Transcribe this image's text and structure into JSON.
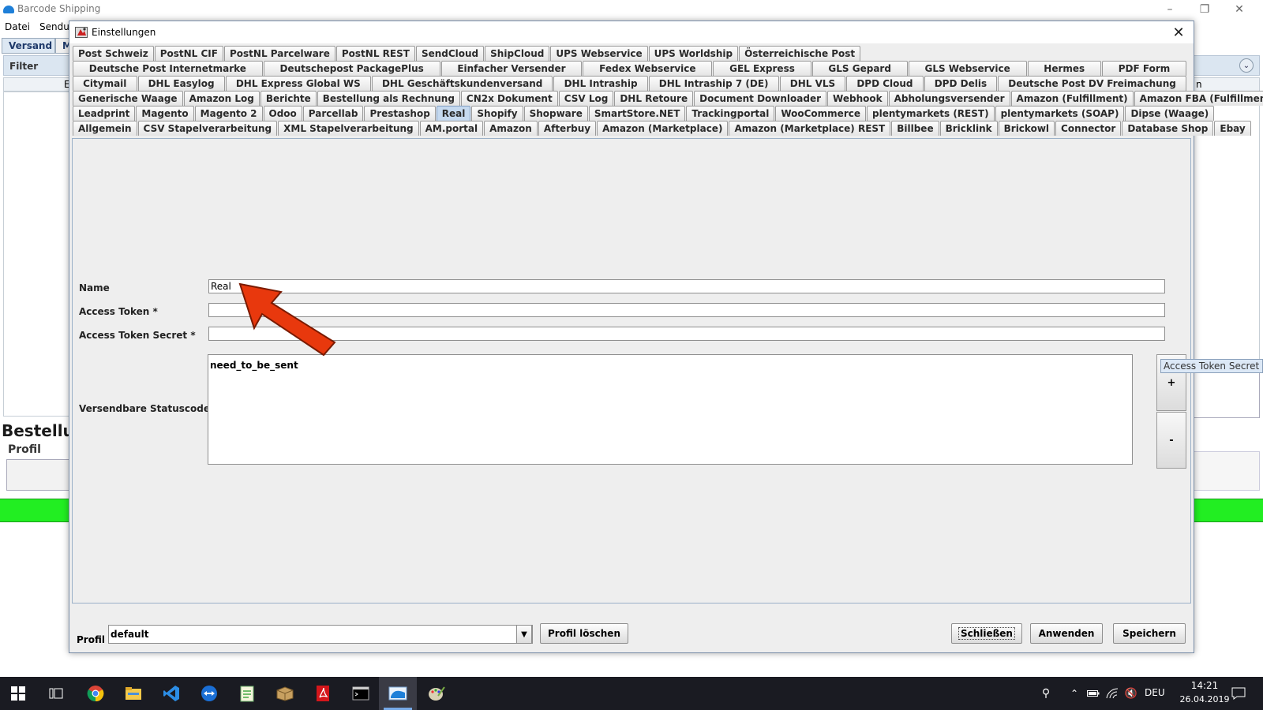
{
  "main": {
    "title": "Barcode Shipping",
    "menu": [
      "Datei",
      "Sendu"
    ],
    "tabs": [
      "Versand",
      "M"
    ],
    "filter_label": "Filter",
    "section_heading": "Bestellu",
    "profile_label": "Profil",
    "col_partial_left": "E",
    "col_partial_right": "n"
  },
  "dialog": {
    "title": "Einstellungen",
    "tab_rows": [
      [
        "Post Schweiz",
        "PostNL CIF",
        "PostNL Parcelware",
        "PostNL REST",
        "SendCloud",
        "ShipCloud",
        "UPS Webservice",
        "UPS Worldship",
        "Österreichische Post"
      ],
      [
        "Deutsche Post Internetmarke",
        "Deutschepost PackagePlus",
        "Einfacher Versender",
        "Fedex Webservice",
        "GEL Express",
        "GLS Gepard",
        "GLS Webservice",
        "Hermes",
        "PDF Form"
      ],
      [
        "Citymail",
        "DHL Easylog",
        "DHL Express Global WS",
        "DHL Geschäftskundenversand",
        "DHL Intraship",
        "DHL Intraship 7 (DE)",
        "DHL VLS",
        "DPD Cloud",
        "DPD Delis",
        "Deutsche Post DV Freimachung"
      ],
      [
        "Generische Waage",
        "Amazon Log",
        "Berichte",
        "Bestellung als Rechnung",
        "CN2x Dokument",
        "CSV Log",
        "DHL Retoure",
        "Document Downloader",
        "Webhook",
        "Abholungsversender",
        "Amazon (Fulfillment)",
        "Amazon FBA (Fulfillment)"
      ],
      [
        "Leadprint",
        "Magento",
        "Magento 2",
        "Odoo",
        "Parcellab",
        "Prestashop",
        "Real",
        "Shopify",
        "Shopware",
        "SmartStore.NET",
        "Trackingportal",
        "WooCommerce",
        "plentymarkets (REST)",
        "plentymarkets (SOAP)",
        "Dipse (Waage)"
      ],
      [
        "Allgemein",
        "CSV Stapelverarbeitung",
        "XML Stapelverarbeitung",
        "AM.portal",
        "Amazon",
        "Afterbuy",
        "Amazon (Marketplace)",
        "Amazon (Marketplace) REST",
        "Billbee",
        "Bricklink",
        "Brickowl",
        "Connector",
        "Database Shop",
        "Ebay"
      ]
    ],
    "selected_tab": "Real",
    "form": {
      "name_label": "Name",
      "name_value": "Real",
      "token_label": "Access Token *",
      "token_value": "",
      "secret_label": "Access Token Secret *",
      "secret_value": "",
      "status_label": "Versendbare Statuscodes *",
      "status_value": "need_to_be_sent",
      "add_label": "+",
      "remove_label": "-",
      "tooltip": "Access Token Secret *"
    },
    "bottom": {
      "profile_label": "Profil",
      "profile_value": "default",
      "delete_label": "Profil löschen",
      "close_label": "Schließen",
      "apply_label": "Anwenden",
      "save_label": "Speichern"
    }
  },
  "taskbar": {
    "icons": [
      "windows-start-icon",
      "task-view-icon",
      "chrome-icon",
      "file-explorer-icon",
      "vscode-icon",
      "teamviewer-icon",
      "notepad-icon",
      "package-icon",
      "acrobat-icon",
      "terminal-icon",
      "barcode-shipping-icon",
      "paint-icon"
    ],
    "language": "DEU",
    "time": "14:21",
    "date": "26.04.2019"
  },
  "colors": {
    "status_green": "#22ee22",
    "arrow_red": "#e8380d",
    "selected_tab": "#c5d9ef"
  }
}
